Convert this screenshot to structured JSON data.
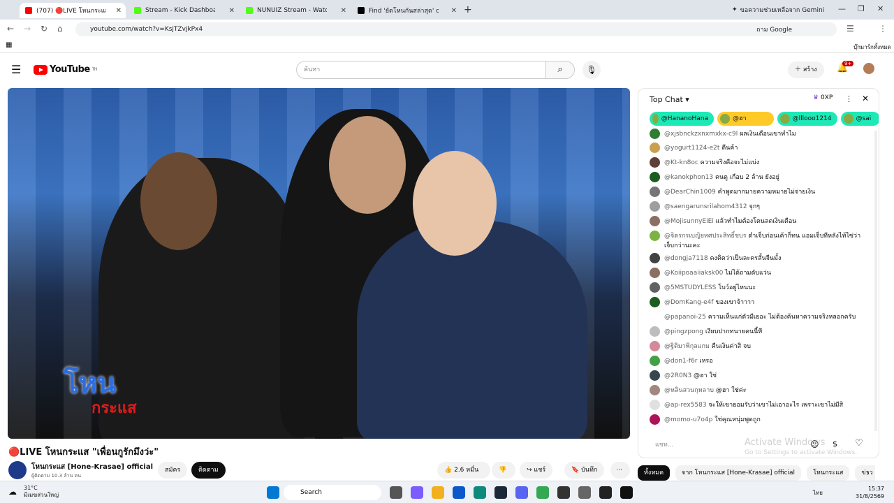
{
  "browser": {
    "tabs": [
      {
        "label": "(707) 🔴LIVE โหนกระแส \"เพื่อ",
        "color": "#ff0000"
      },
      {
        "label": "Stream - Kick Dashboard",
        "color": "#53fc18"
      },
      {
        "label": "NUNUIZ Stream - Watch Live o",
        "color": "#53fc18"
      },
      {
        "label": "Find 'ยัดโหนกันสล่าสุด' on TikTok",
        "color": "#000000"
      }
    ],
    "gemini": "ขอความช่วยเหลือจาก Gemini",
    "url": "youtube.com/watch?v=KsjTZvjkPx4",
    "google_search": "ถาม Google",
    "bookmarks": "บุ๊กมาร์กทั้งหมด"
  },
  "youtube": {
    "logo": "YouTube",
    "region": "TH",
    "search_placeholder": "ค้นหา",
    "create": "สร้าง",
    "notif_count": "9+"
  },
  "video": {
    "title": "🔴LIVE โหนกระแส \"เพื่อนกูรักมึงว่ะ\"",
    "overlay_logo_top": "โหน",
    "overlay_logo_bottom": "กระแส",
    "channel_name": "โหนกระแส [Hone-Krasae] official",
    "subscribers": "ผู้ติดตาม 10.3 ล้าน คน",
    "join": "สมัคร",
    "subscribe": "ติดตาม",
    "likes": "2.6 หมื่น",
    "share": "แชร์",
    "save": "บันทึก"
  },
  "chat": {
    "title": "Top Chat",
    "points": "0XP",
    "pinned": [
      {
        "label": "@HananoHana",
        "color": "#1de9b6"
      },
      {
        "label": "@ฮา",
        "color": "#ffca28"
      },
      {
        "label": "@lllooo1214",
        "color": "#1de9b6"
      },
      {
        "label": "@sai",
        "color": "#1de9b6"
      }
    ],
    "messages": [
      {
        "author": "@xjsbnckzxnxmxkx-c9l",
        "text": "ผลเงินเดือนเขาทำไม",
        "color": "#2e7d32"
      },
      {
        "author": "@yogurt1124-e2t",
        "text": "ดีนค้า",
        "color": "#c8a050"
      },
      {
        "author": "@Kt-kn8oc",
        "text": "ความจริงคือจะไม่แบ่ง",
        "color": "#5d4037"
      },
      {
        "author": "@kanokphon13",
        "text": "คนดู เกือบ 2 ล้าน ยังอยู่",
        "color": "#1b5e20"
      },
      {
        "author": "@DearChin1009",
        "text": "คำพูดมากมายความหมายไม่จ่ายเงิน",
        "color": "#757575"
      },
      {
        "author": "@saengarunsrilahom4312",
        "text": "จุกๆ",
        "color": "#9e9e9e"
      },
      {
        "author": "@MojisunnyEiEi",
        "text": "แล้วทำไมต้องโดนลดเงินเดือน",
        "color": "#8d6e63"
      },
      {
        "author": "@จิตรกรเบญิยทศประสิทธิ์ชบร",
        "text": "ตำเจ็บก่อนเค้าก็ทน แอมเจ็บทีหลังไท้ไซ่ว่าเจ็บกว่านะคะ",
        "color": "#7cb342"
      },
      {
        "author": "@dongja7118",
        "text": "คงคิดว่าเป็นละครสั้นจีนมั้ง",
        "color": "#424242"
      },
      {
        "author": "@Koiipoaaiiaksk00",
        "text": "ไม่ได้ถามดับแว่น",
        "color": "#8d6e63"
      },
      {
        "author": "@5MSTUDYLESS",
        "text": "โบว์อยู่ไหนนะ",
        "color": "#616161"
      },
      {
        "author": "@DomKang-e4f",
        "text": "ของเขาจ้าาาา",
        "color": "#1b5e20"
      },
      {
        "author": "@papanoi-25",
        "text": "ความเห็นแก่ตัวมีเยอะ ไม่ต้องค้นหาความจริงหลอกครับ",
        "color": "#ffffff"
      },
      {
        "author": "@pingzpong",
        "text": "เงียบปากทนายคนนี้ที",
        "color": "#bdbdbd"
      },
      {
        "author": "@ฐิติมาพิกุลแกม",
        "text": "คืนเงินค่าสิ จบ",
        "color": "#d48a9a"
      },
      {
        "author": "@don1-f6r",
        "text": "เหรอ",
        "color": "#43a047"
      },
      {
        "author": "@2R0N3",
        "text": "@ฮา ใช่",
        "color": "#37474f"
      },
      {
        "author": "@หลินสวนกุหลาบ",
        "text": "@ฮา ใช่ค่ะ",
        "color": "#a1887f"
      },
      {
        "author": "@ap-rex5583",
        "text": "จะให้เขายอมรับว่าเขาไม่เอาอะไร เพราะเขาไม่มีสิ",
        "color": "#e0e0e0"
      },
      {
        "author": "@momo-u7o4p",
        "text": "ใช่คุณหนุ่มพูดถูก",
        "color": "#ad1457"
      }
    ],
    "input_placeholder": "แชท..."
  },
  "watermark": {
    "line1": "Activate Windows",
    "line2": "Go to Settings to activate Windows."
  },
  "chips": [
    {
      "label": "ทั้งหมด",
      "active": true
    },
    {
      "label": "จาก โหนกระแส [Hone-Krasae] official",
      "active": false
    },
    {
      "label": "โหนกระแส",
      "active": false
    },
    {
      "label": "ข่าว",
      "active": false
    }
  ],
  "taskbar": {
    "temp": "31°C",
    "weather": "มีเมฆส่วนใหญ่",
    "search": "Search",
    "lang": "ไทย",
    "time": "15:37",
    "date": "31/8/2569"
  }
}
